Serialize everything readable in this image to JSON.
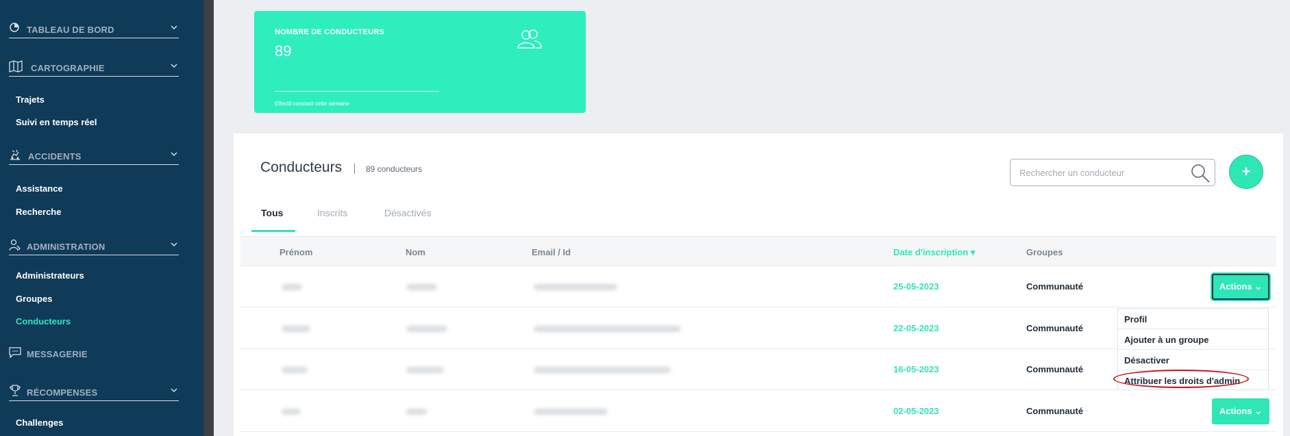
{
  "sidebar": {
    "sections": {
      "dashboard": "TABLEAU DE BORD",
      "mapping": "CARTOGRAPHIE",
      "accidents": "ACCIDENTS",
      "administration": "ADMINISTRATION",
      "messaging": "MESSAGERIE",
      "rewards": "RÉCOMPENSES"
    },
    "items": {
      "trips": "Trajets",
      "realtime": "Suivi en temps réel",
      "assistance": "Assistance",
      "search": "Recherche",
      "admins": "Administrateurs",
      "groups": "Groupes",
      "drivers": "Conducteurs",
      "challenges": "Challenges"
    }
  },
  "stat_card": {
    "title": "NOMBRE DE CONDUCTEURS",
    "value": "89",
    "note": "Effectif constant cette semaine",
    "icon": "users-icon"
  },
  "main": {
    "title": "Conducteurs",
    "count": "89 conducteurs",
    "search_placeholder": "Rechercher un conducteur",
    "add_label": "+",
    "tabs": [
      "Tous",
      "Inscrits",
      "Désactivés"
    ],
    "active_tab": "Tous",
    "columns": {
      "first_name": "Prénom",
      "last_name": "Nom",
      "email": "Email / Id",
      "date": "Date d'inscription ▾",
      "groups": "Groupes"
    },
    "rows": [
      {
        "date": "25-05-2023",
        "group": "Communauté",
        "action": "Actions ⌄"
      },
      {
        "date": "22-05-2023",
        "group": "Communauté"
      },
      {
        "date": "16-05-2023",
        "group": "Communauté"
      },
      {
        "date": "02-05-2023",
        "group": "Communauté",
        "action": "Actions ⌄"
      }
    ],
    "dropdown": [
      "Profil",
      "Ajouter à un groupe",
      "Désactiver",
      "Attribuer les droits d'admin"
    ]
  },
  "colors": {
    "accent": "#2ee6b6",
    "sidebar_bg": "#0f3a58",
    "annotation": "#c8121c"
  }
}
